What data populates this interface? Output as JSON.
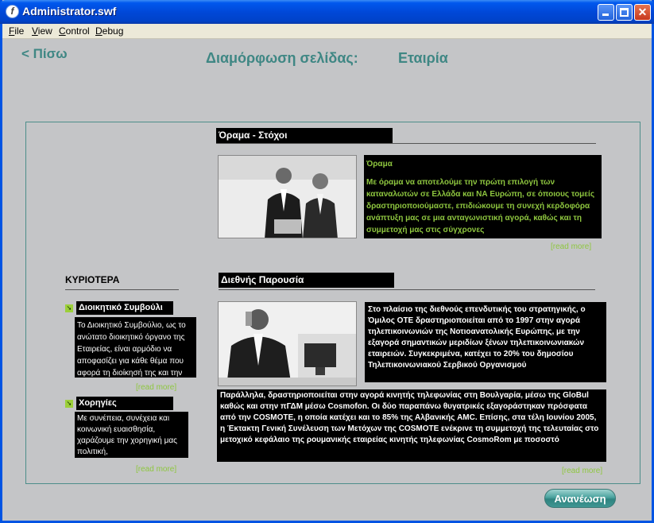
{
  "window": {
    "title": "Administrator.swf",
    "menu": [
      {
        "underline": "F",
        "rest": "ile"
      },
      {
        "underline": "V",
        "rest": "iew"
      },
      {
        "underline": "C",
        "rest": "ontrol"
      },
      {
        "underline": "D",
        "rest": "ebug"
      }
    ]
  },
  "header": {
    "back_label": "< Πίσω",
    "title_label": "Διαμόρφωση σελίδας:",
    "title_value": "Εταιρία"
  },
  "vision": {
    "heading": "Όραμα - Στόχοι",
    "text_title": "Όραμα",
    "text_body": "Με όραμα να αποτελούμε την πρώτη επιλογή των καταναλωτών σε Ελλάδα και ΝΑ Ευρώπη, σε όποιους τομείς δραστηριοποιούμαστε, επιδιώκουμε τη συνεχή κερδοφόρα ανάπτυξη μας σε μια ανταγωνιστική αγορά, καθώς και τη συμμετοχή μας στις σύγχρονες",
    "read_more": "[read more]"
  },
  "international": {
    "heading": "Διεθνής Παρουσία",
    "text_side": "Στο πλαίσιο της διεθνούς επενδυτικής του στρατηγικής, ο Όμιλος ΟΤΕ δραστηριοποιείται από το 1997 στην αγορά τηλεπικοινωνιών της Νοτιοανατολικής Ευρώπης, με την εξαγορά σημαντικών μεριδίων ξένων τηλεπικοινωνιακών εταιρειών. Συγκεκριμένα, κατέχει το 20% του δημοσίου Τηλεπικοινωνιακού Σερβικού Οργανισμού",
    "text_wide": "Παράλληλα, δραστηριοποιείται στην αγορά κινητής τηλεφωνίας στη Βουλγαρία, μέσω της GloBul καθώς και στην πΓΔΜ μέσω Cosmofon. Οι δύο παραπάνω θυγατρικές εξαγοράστηκαν πρόσφατα από την COSMOTE, η οποία κατέχει και το 85% της Αλβανικής AMC. Επίσης, στα τέλη Ιουνίου 2005, η Έκτακτη Γενική Συνέλευση των Μετόχων της COSMOTE ενέκρινε τη συμμετοχή της τελευταίας στο μετοχικό κεφάλαιο της ρουμανικής εταιρείας κινητής τηλεφωνίας CosmoRom με ποσοστό",
    "read_more": "[read more]"
  },
  "sidebar": {
    "heading": "ΚΥΡΙΟΤΕΡΑ",
    "items": [
      {
        "label": "Διοικητικό Συμβούλι",
        "text": "Το Διοικητικό Συμβούλιο, ως το ανώτατο διοικητικό όργανο της Εταιρείας, είναι αρμόδιο να αποφασίζει για κάθε θέμα που αφορά τη διοίκησή της και την",
        "read_more": "[read more]"
      },
      {
        "label": "Χορηγίες",
        "text": "Με συνέπεια, συνέχεια και κοινωνική ευαισθησία, χαράζουμε την χορηγική μας πολιτική,",
        "read_more": "[read more]"
      }
    ]
  },
  "footer": {
    "refresh_label": "Ανανέωση"
  },
  "colors": {
    "accent": "#3f8784",
    "green_text": "#8ec63f",
    "panel_bg": "#c4c5c7"
  },
  "icons": [
    "app-icon",
    "minimize-icon",
    "maximize-icon",
    "close-icon",
    "arrow-bullet-icon"
  ]
}
